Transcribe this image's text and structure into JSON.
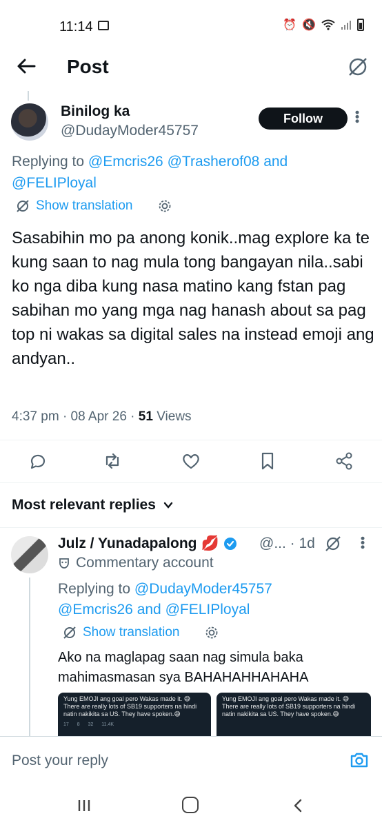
{
  "status_bar": {
    "time": "11:14"
  },
  "header": {
    "title": "Post"
  },
  "post": {
    "display_name": "Binilog ka",
    "handle": "@DudayModer45757",
    "follow_label": "Follow",
    "replying_prefix": "Replying to",
    "replying_mentions": [
      "@Emcris26",
      "@Trasherof08"
    ],
    "replying_joiner": "and",
    "replying_last": "@FELIPloyal",
    "show_translation": "Show translation",
    "body": "Sasabihin mo pa anong konik..mag explore ka te kung saan to nag mula tong bangayan nila..sabi ko nga diba kung nasa matino kang fstan pag sabihan mo yang mga nag hanash about sa pag top ni wakas sa digital sales na instead emoji ang andyan..",
    "time": "4:37 pm",
    "date": "08 Apr 26",
    "views_count": "51",
    "views_label": "Views"
  },
  "replies_section": {
    "sort_label": "Most relevant replies"
  },
  "reply": {
    "display_name": "Julz / Yunadapalong",
    "emoji": "💋",
    "handle": "@...",
    "age": "1d",
    "commentary_label": "Commentary account",
    "replying_prefix": "Replying to",
    "replying_first": "@DudayModer45757",
    "replying_second": "@Emcris26",
    "replying_joiner": "and",
    "replying_last": "@FELIPloyal",
    "show_translation": "Show translation",
    "body": "Ako na maglapag saan nag simula baka mahimasmasan sya BAHAHAHHAHAHA",
    "media": [
      {
        "text": "Yung EMOJI ang goal pero Wakas made it. 😅 There are really lots of SB19 supporters na hindi natin nakikita sa US. They have spoken.😅",
        "stats": "17 8 32 11.4K"
      },
      {
        "text": "Yung EMOJI ang goal pero Wakas made it. 😅 There are really lots of SB19 supporters na hindi natin nakikita sa US. They have spoken.😅",
        "stats": ""
      }
    ]
  },
  "compose": {
    "placeholder": "Post your reply"
  },
  "colors": {
    "accent": "#1d9bf0",
    "text": "#0f1419",
    "muted": "#536471"
  }
}
